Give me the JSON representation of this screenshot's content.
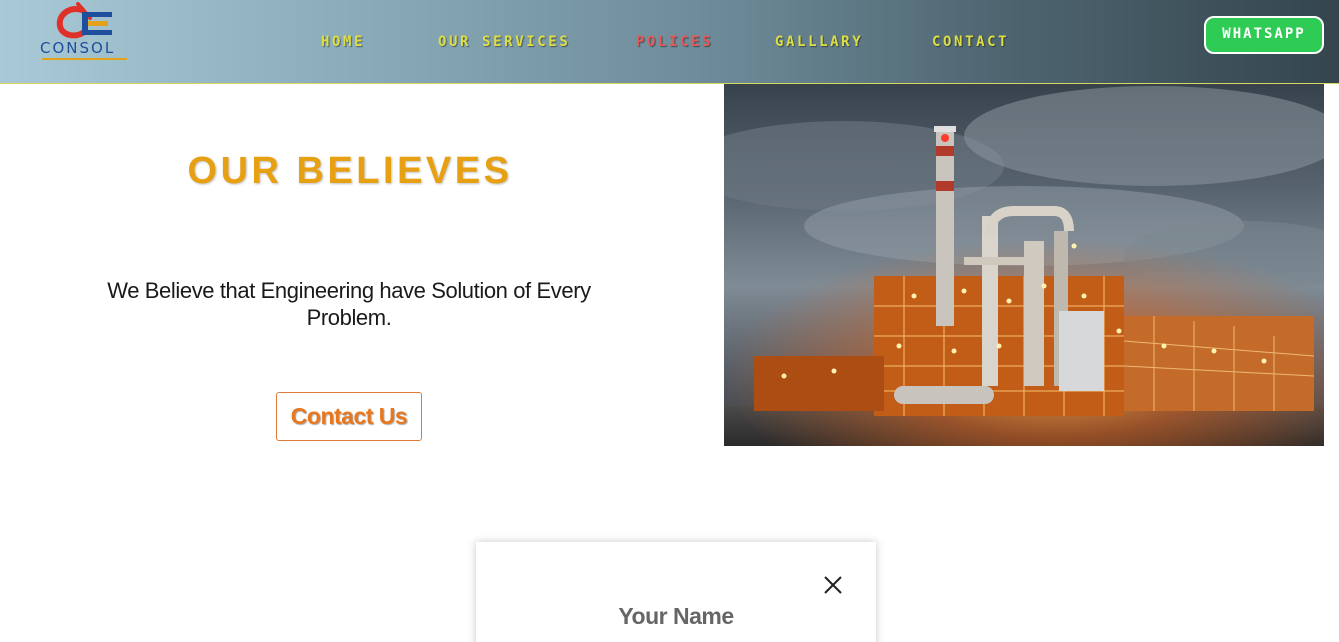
{
  "brand": {
    "logo_text": "CONSOL",
    "logo_mark": "CE",
    "colors": {
      "blue": "#1f4e9c",
      "red": "#e0302a",
      "gold": "#e3a21a"
    }
  },
  "nav": {
    "items": [
      {
        "label": "HOME",
        "active": false
      },
      {
        "label": "OUR SERVICES",
        "active": false
      },
      {
        "label": "POLICES",
        "active": true
      },
      {
        "label": "GALLLARY",
        "active": false
      },
      {
        "label": "CONTACT",
        "active": false
      }
    ],
    "whatsapp_label": "WHATSAPP"
  },
  "hero": {
    "title": "OUR BELIEVES",
    "description": "We Believe that Engineering have Solution of Every Problem.",
    "cta_label": "Contact Us",
    "image_icon": "refinery-photo"
  },
  "popup": {
    "field_label": "Your Name",
    "close_icon": "close-icon"
  },
  "theme": {
    "nav_text": "#dede44",
    "nav_active": "#e65858",
    "accent_orange": "#e8a013",
    "whatsapp_green": "#2ecc55"
  }
}
